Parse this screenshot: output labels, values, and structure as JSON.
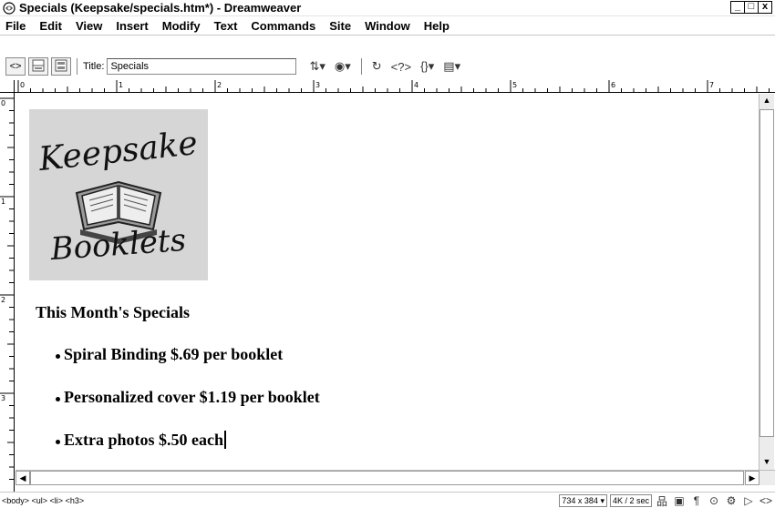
{
  "window": {
    "title": "Specials (Keepsake/specials.htm*) - Dreamweaver",
    "buttons": [
      "_",
      "□",
      "x"
    ]
  },
  "menu": [
    "File",
    "Edit",
    "View",
    "Insert",
    "Modify",
    "Text",
    "Commands",
    "Site",
    "Window",
    "Help"
  ],
  "toolbar": {
    "title_label": "Title:",
    "title_value": "Specials",
    "icons": [
      "code-view-icon",
      "split-view-icon",
      "design-view-icon",
      "file-management-icon",
      "preview-browser-icon",
      "refresh-icon",
      "reference-icon",
      "code-navigation-icon",
      "view-options-icon"
    ]
  },
  "rulers": {
    "horizontal_labels": [
      "0",
      "1",
      "2",
      "3",
      "4",
      "5",
      "6",
      "7"
    ],
    "vertical_labels": [
      "0",
      "1",
      "2",
      "3"
    ]
  },
  "document": {
    "logo_text_top": "Keepsake",
    "logo_text_bottom": "Booklets",
    "heading": "This Month's Specials",
    "items": [
      "Spiral Binding $.69 per booklet",
      "Personalized cover $1.19 per booklet",
      "Extra photos $.50 each"
    ]
  },
  "statusbar": {
    "tag_selector": "<body> <ul> <li> <h3>",
    "window_size": "734 x 384",
    "download_stats": "4K / 2 sec",
    "launcher_icons": [
      "site-icon",
      "assets-icon",
      "html-styles-icon",
      "css-styles-icon",
      "behaviors-icon",
      "history-icon",
      "code-inspector-icon"
    ]
  }
}
